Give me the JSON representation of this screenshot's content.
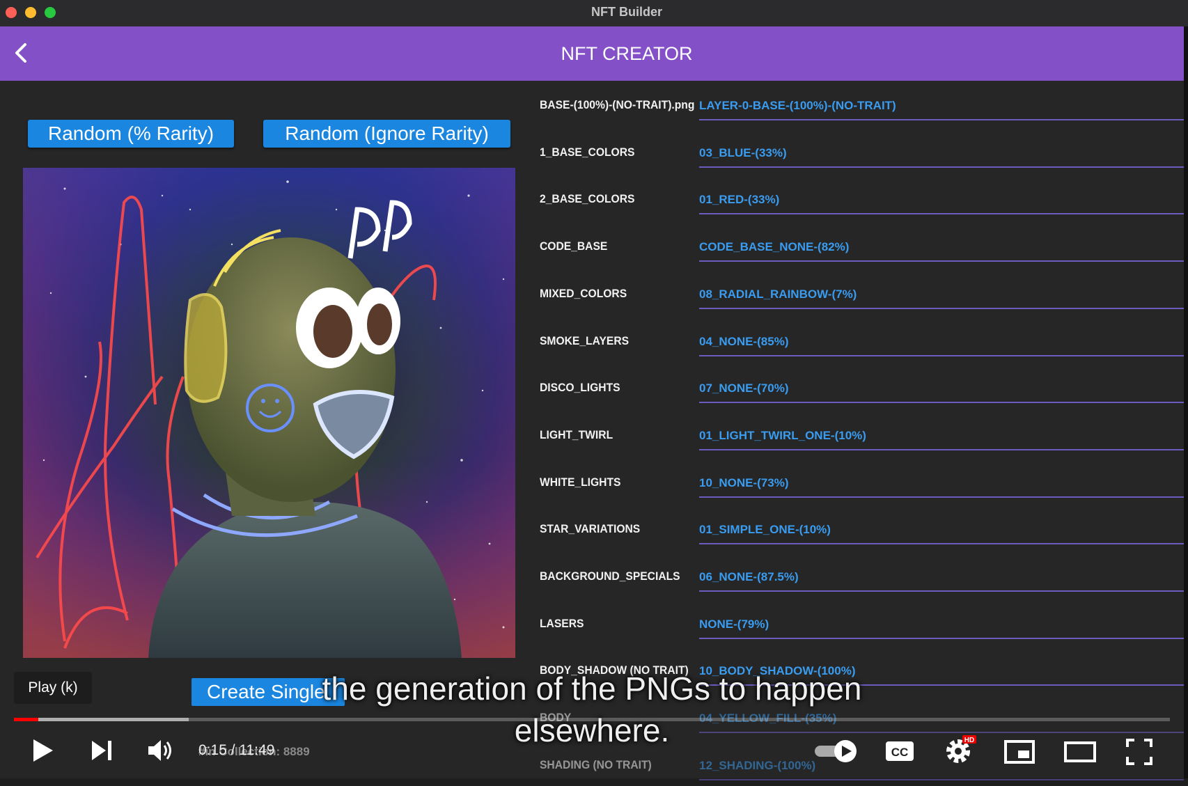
{
  "window": {
    "title": "NFT Builder"
  },
  "appbar": {
    "title": "NFT CREATOR"
  },
  "buttons": {
    "random_rarity": "Random (% Rarity)",
    "random_ignore": "Random (Ignore Rarity)",
    "create_single": "Create Single"
  },
  "traits": [
    {
      "label": "BASE-(100%)-(NO-TRAIT).png",
      "value": "LAYER-0-BASE-(100%)-(NO-TRAIT)"
    },
    {
      "label": "1_BASE_COLORS",
      "value": "03_BLUE-(33%)"
    },
    {
      "label": "2_BASE_COLORS",
      "value": "01_RED-(33%)"
    },
    {
      "label": "CODE_BASE",
      "value": "CODE_BASE_NONE-(82%)"
    },
    {
      "label": "MIXED_COLORS",
      "value": "08_RADIAL_RAINBOW-(7%)"
    },
    {
      "label": "SMOKE_LAYERS",
      "value": "04_NONE-(85%)"
    },
    {
      "label": "DISCO_LIGHTS",
      "value": "07_NONE-(70%)"
    },
    {
      "label": "LIGHT_TWIRL",
      "value": "01_LIGHT_TWIRL_ONE-(10%)"
    },
    {
      "label": "WHITE_LIGHTS",
      "value": "10_NONE-(73%)"
    },
    {
      "label": "STAR_VARIATIONS",
      "value": "01_SIMPLE_ONE-(10%)"
    },
    {
      "label": "BACKGROUND_SPECIALS",
      "value": "06_NONE-(87.5%)"
    },
    {
      "label": "LASERS",
      "value": "NONE-(79%)"
    },
    {
      "label": "BODY_SHADOW (NO TRAIT)",
      "value": "10_BODY_SHADOW-(100%)"
    },
    {
      "label": "BODY",
      "value": "04_YELLOW_FILL-(35%)"
    },
    {
      "label": "SHADING (NO TRAIT)",
      "value": "12_SHADING-(100%)"
    }
  ],
  "collection_text": "#in Collection: 8889",
  "player": {
    "tooltip": "Play (k)",
    "time": "0:15 / 11:49",
    "progress_played_fraction": 0.021,
    "progress_buffered_fraction": 0.151,
    "caption_line1": "the generation of the PNGs to happen",
    "caption_line2": "elsewhere.",
    "hd_badge": "HD",
    "icons": [
      "play-icon",
      "next-icon",
      "volume-icon",
      "autoplay-toggle-icon",
      "captions-icon",
      "settings-icon",
      "miniplayer-icon",
      "theater-icon",
      "fullscreen-icon"
    ]
  },
  "colors": {
    "accent": "#8350c8",
    "button": "#1a86e0",
    "value_text": "#3a9cf0",
    "progress": "#ff0000"
  }
}
